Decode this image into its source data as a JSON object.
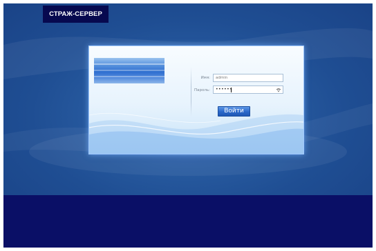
{
  "header": {
    "brand": "СТРАЖ-СЕРВЕР"
  },
  "login": {
    "username_label": "Имя:",
    "username_value": "admin",
    "password_label": "Пароль:",
    "password_value": "••••••",
    "submit_label": "Войти",
    "password_toggle_icon": "eye-icon"
  },
  "colors": {
    "background_top": "#275a9f",
    "background_bottom": "#0a0f66",
    "brand_bg": "#07094f",
    "button": "#2a67c9"
  }
}
